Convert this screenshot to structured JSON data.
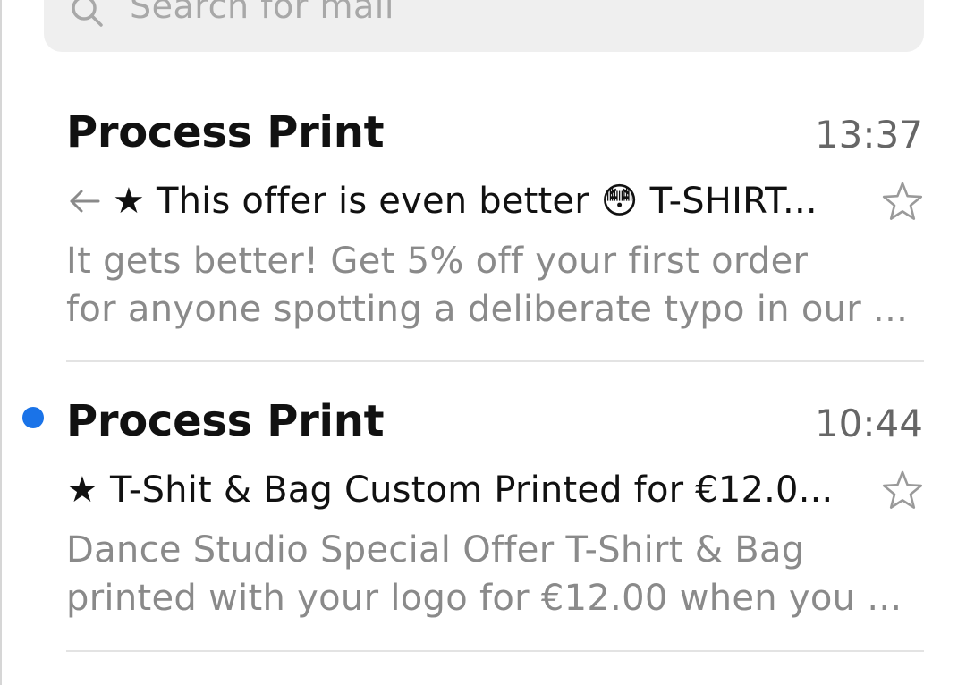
{
  "search": {
    "placeholder": "Search for mail"
  },
  "mails": [
    {
      "sender": "Process Print",
      "time": "13:37",
      "replied": true,
      "unread": false,
      "subject": "★ This offer is even better 😳  T-SHIRT...",
      "preview_line1": "It gets better! Get 5% off your first order",
      "preview_line2": "for anyone spotting a deliberate typo in our ..."
    },
    {
      "sender": "Process Print",
      "time": "10:44",
      "replied": false,
      "unread": true,
      "subject": "★ T-Shit & Bag Custom Printed for €12.0...",
      "preview_line1": "Dance Studio Special Offer T-Shirt & Bag",
      "preview_line2": "printed with your logo for €12.00 when you ..."
    }
  ],
  "icons": {
    "search": "search-icon",
    "reply": "reply-arrow-icon",
    "star": "star-outline-icon"
  },
  "colors": {
    "unread_dot": "#1a73e8",
    "search_bg": "#efefef",
    "preview_text": "#8a8a8a"
  }
}
